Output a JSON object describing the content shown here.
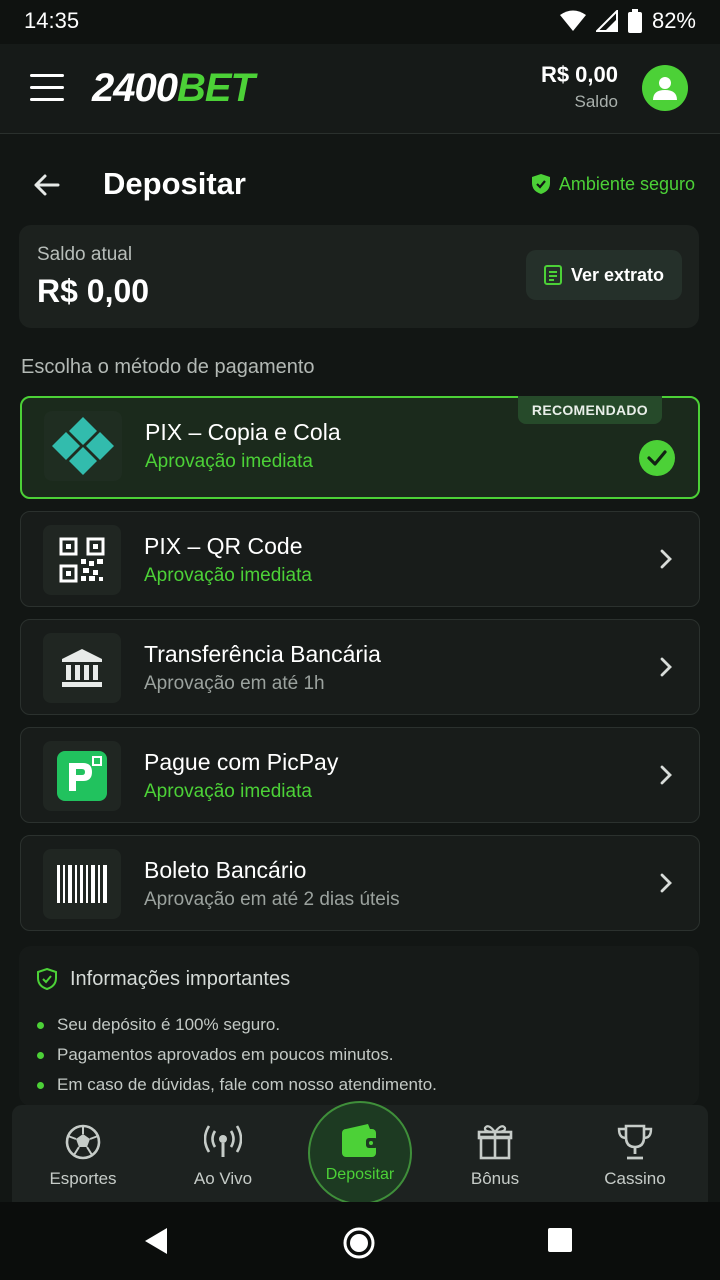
{
  "status_bar": {
    "time": "14:35",
    "battery": "82%"
  },
  "header": {
    "logo_white": "2400",
    "logo_green": "BET",
    "balance_amount": "R$ 0,00",
    "balance_label": "Saldo"
  },
  "page": {
    "title": "Depositar",
    "secure_label": "Ambiente seguro"
  },
  "balance_card": {
    "label": "Saldo atual",
    "value": "R$ 0,00",
    "statement_button": "Ver extrato"
  },
  "section_label": "Escolha o método de pagamento",
  "payment_methods": [
    {
      "title": "PIX – Copia e Cola",
      "subtitle": "Aprovação imediata",
      "badge": "RECOMENDADO",
      "selected": true,
      "icon": "pix-icon"
    },
    {
      "title": "PIX – QR Code",
      "subtitle": "Aprovação imediata",
      "icon": "qr-code-icon"
    },
    {
      "title": "Transferência Bancária",
      "subtitle": "Aprovação em até 1h",
      "icon": "bank-icon"
    },
    {
      "title": "Pague com PicPay",
      "subtitle": "Aprovação imediata",
      "icon": "picpay-icon"
    },
    {
      "title": "Boleto Bancário",
      "subtitle": "Aprovação em até 2 dias úteis",
      "icon": "barcode-icon"
    }
  ],
  "info": {
    "title": "Informações importantes",
    "items": [
      "Seu depósito é 100% seguro.",
      "Pagamentos aprovados em poucos minutos.",
      "Em caso de dúvidas, fale com nosso atendimento."
    ]
  },
  "bottom_nav": {
    "items": [
      {
        "label": "Esportes",
        "icon": "soccer-ball-icon"
      },
      {
        "label": "Ao Vivo",
        "icon": "live-broadcast-icon"
      },
      {
        "label": "Depositar",
        "icon": "wallet-icon",
        "active": true
      },
      {
        "label": "Bônus",
        "icon": "gift-icon"
      },
      {
        "label": "Cassino",
        "icon": "trophy-icon"
      }
    ]
  },
  "colors": {
    "accent": "#4cd137",
    "background": "#121614",
    "card": "#181c1a"
  }
}
